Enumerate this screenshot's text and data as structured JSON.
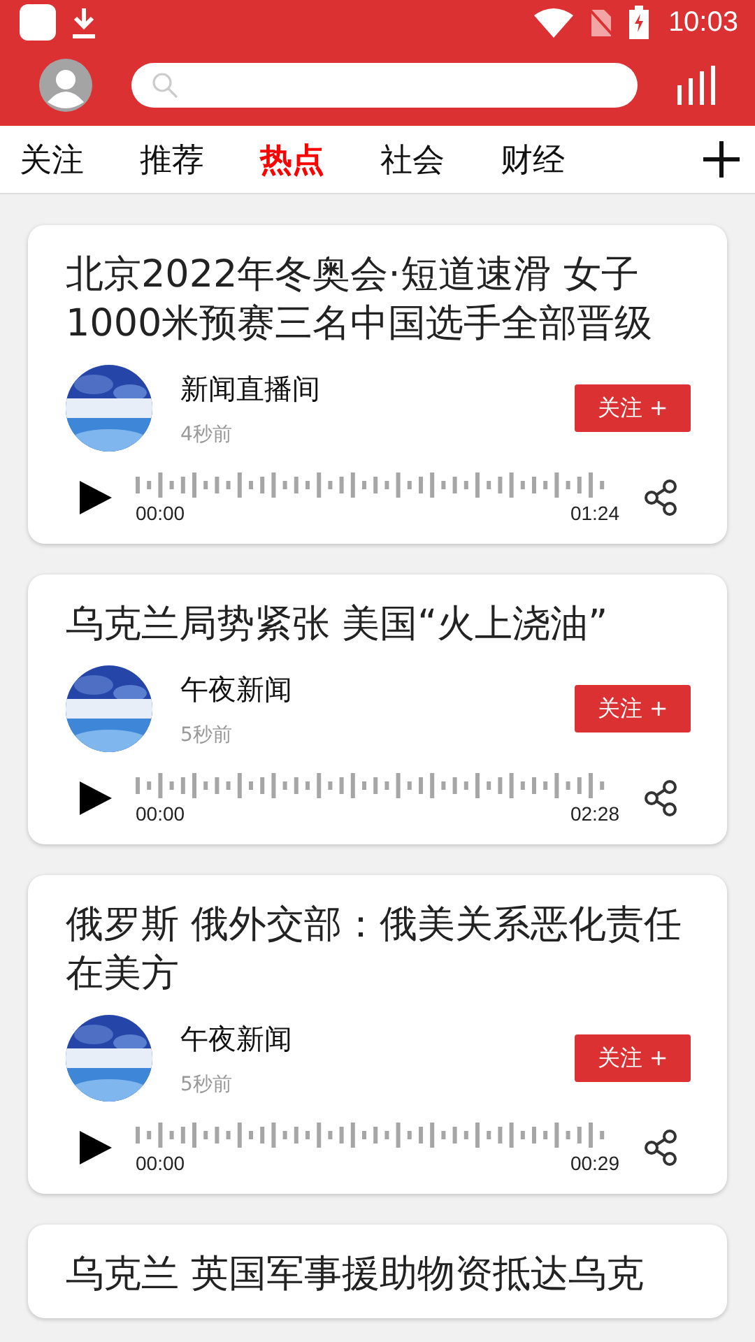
{
  "status_bar": {
    "time": "10:03"
  },
  "tabs": [
    {
      "label": "关注",
      "selected": false
    },
    {
      "label": "推荐",
      "selected": false
    },
    {
      "label": "热点",
      "selected": true
    },
    {
      "label": "社会",
      "selected": false
    },
    {
      "label": "财经",
      "selected": false
    }
  ],
  "feed": [
    {
      "title": "北京2022年冬奥会·短道速滑 女子1000米预赛三名中国选手全部晋级",
      "source": "新闻直播间",
      "time_ago": "4秒前",
      "follow_label": "关注 +",
      "start": "00:00",
      "duration": "01:24"
    },
    {
      "title": "乌克兰局势紧张 美国“火上浇油”",
      "source": "午夜新闻",
      "time_ago": "5秒前",
      "follow_label": "关注 +",
      "start": "00:00",
      "duration": "02:28"
    },
    {
      "title": "俄罗斯 俄外交部：俄美关系恶化责任在美方",
      "source": "午夜新闻",
      "time_ago": "5秒前",
      "follow_label": "关注 +",
      "start": "00:00",
      "duration": "00:29"
    },
    {
      "title": "乌克兰 英国军事援助物资抵达乌克"
    }
  ]
}
